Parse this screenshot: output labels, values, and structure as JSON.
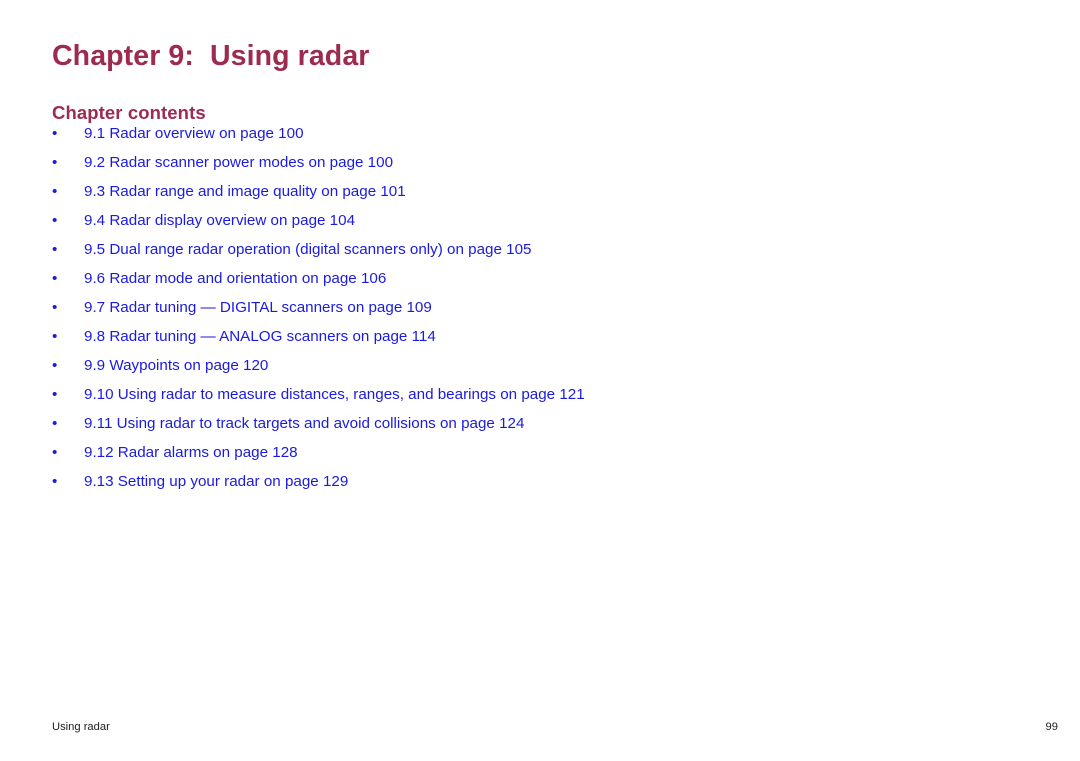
{
  "document": {
    "background_color": "#ffffff",
    "accent_color": "#9c2b4f",
    "link_color": "#1a1ae0",
    "footer_color": "#1c1c1c"
  },
  "chapter": {
    "title": "Chapter 9:  Using radar",
    "contents_heading": "Chapter contents"
  },
  "contents": {
    "bullet_glyph": "•",
    "items": [
      {
        "label": "9.1 Radar overview on page 100"
      },
      {
        "label": "9.2 Radar scanner power modes on page 100"
      },
      {
        "label": "9.3 Radar range and image quality on page 101"
      },
      {
        "label": "9.4 Radar display overview on page 104"
      },
      {
        "label": "9.5 Dual range radar operation (digital scanners only) on page 105"
      },
      {
        "label": "9.6 Radar mode and orientation on page 106"
      },
      {
        "label": "9.7 Radar tuning — DIGITAL scanners on page 109"
      },
      {
        "label": "9.8 Radar tuning — ANALOG scanners on page 114"
      },
      {
        "label": "9.9 Waypoints on page 120"
      },
      {
        "label": "9.10 Using radar to measure distances, ranges, and bearings on page 121"
      },
      {
        "label": "9.11 Using radar to track targets and avoid collisions on page 124"
      },
      {
        "label": "9.12 Radar alarms on page 128"
      },
      {
        "label": "9.13 Setting up your radar on page 129"
      }
    ]
  },
  "footer": {
    "left_text": "Using radar",
    "page_number": "99"
  }
}
